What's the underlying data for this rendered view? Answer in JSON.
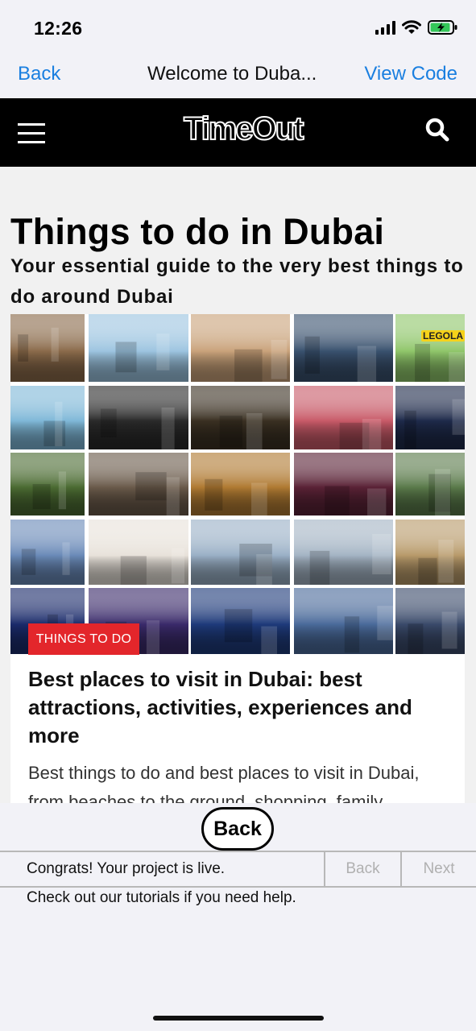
{
  "status_bar": {
    "time": "12:26",
    "battery_color": "#34c759"
  },
  "nav": {
    "back_label": "Back",
    "title": "Welcome to Duba...",
    "view_code_label": "View Code",
    "accent_color": "#1a7fe0"
  },
  "site": {
    "logo": "TimeOut",
    "menu_icon": "hamburger-icon",
    "search_icon": "search-icon"
  },
  "article_page": {
    "title": "Things to do in Dubai",
    "subtitle": "Your essential guide to the very best things to do around Dubai"
  },
  "mosaic": {
    "legoland_sign": "LEGOLA",
    "tile_colors": [
      "#8a6a4a",
      "#9cc4e0",
      "#c9a27a",
      "#39516e",
      "#8fc66a",
      "#7fb8d8",
      "#2a2a2a",
      "#3a3022",
      "#c85a68",
      "#1e2a4a",
      "#4b6b32",
      "#6a5a4a",
      "#b07a32",
      "#5a2236",
      "#5a7a4a",
      "#6a8ab8",
      "#e8e2da",
      "#9ab0c6",
      "#a4b4c4",
      "#b89a6a",
      "#1a2a6a",
      "#3a2a6a",
      "#1e3a7a",
      "#4a6a9a",
      "#3a4a6a"
    ]
  },
  "card": {
    "badge": "THINGS TO DO",
    "badge_color": "#e3262b",
    "title": "Best places to visit in Dubai: best attractions, activities, experiences and more",
    "description": "Best things to do and best places to visit in Dubai, from beaches to the ground, shopping, family"
  },
  "bottom": {
    "back_label": "Back",
    "live_message": "Congrats! Your project is live.",
    "prev_label": "Back",
    "next_label": "Next",
    "help_message": "Check out our tutorials if you need help."
  }
}
